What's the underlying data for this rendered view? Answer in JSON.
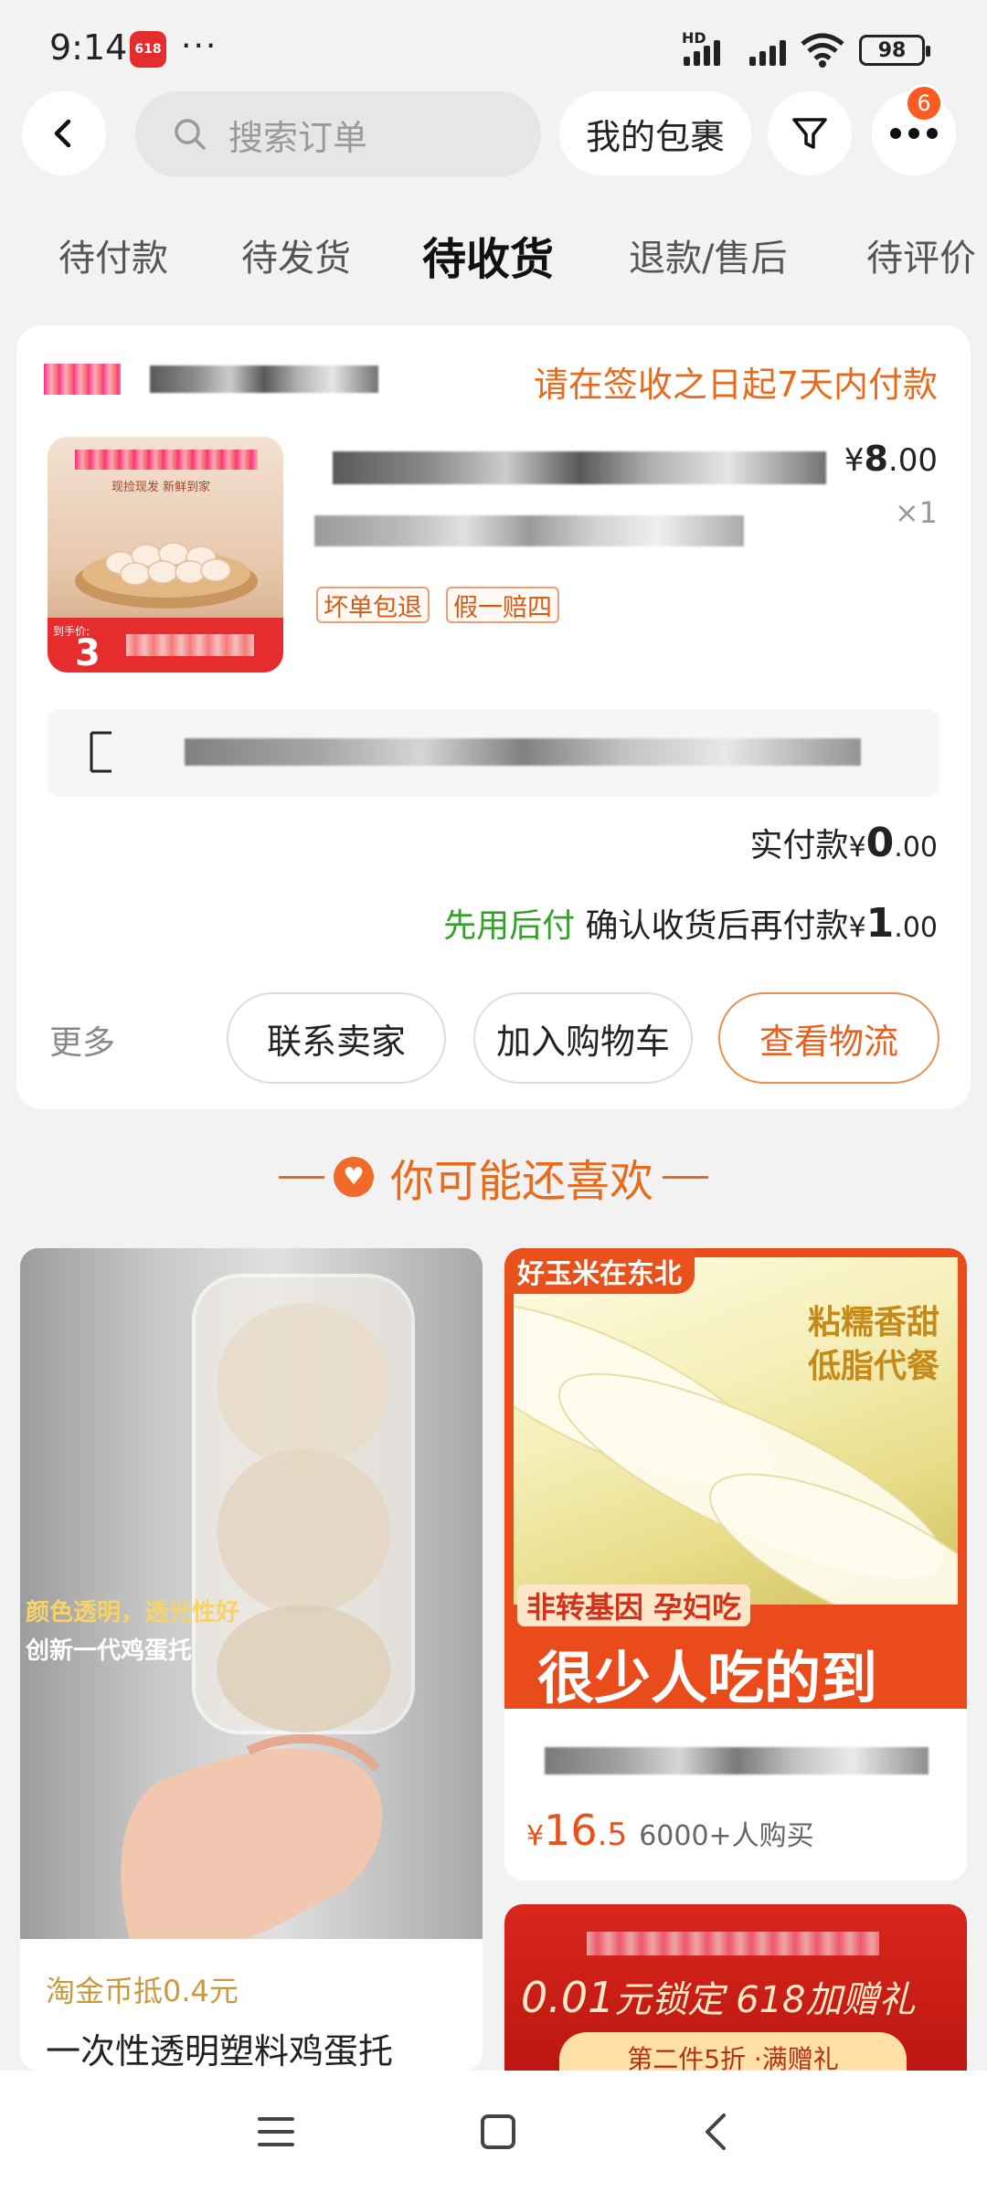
{
  "status_bar": {
    "time": "9:14",
    "app_badge_text": "618",
    "more_dots": "···",
    "network_label": "HD",
    "battery": "98"
  },
  "header": {
    "search_placeholder": "搜索订单",
    "my_packages": "我的包裹",
    "notification_count": "6"
  },
  "tabs": [
    {
      "label": "待付款",
      "active": false
    },
    {
      "label": "待发货",
      "active": false
    },
    {
      "label": "待收货",
      "active": true
    },
    {
      "label": "退款/售后",
      "active": false
    },
    {
      "label": "待评价",
      "active": false
    }
  ],
  "order": {
    "payment_notice": "请在签收之日起7天内付款",
    "thumb_text_top": "现捡现发 新鲜到家",
    "thumb_price_label": "到手价:",
    "thumb_price": "3",
    "unit_price_symbol": "¥",
    "unit_price_int": "8",
    "unit_price_dec": ".00",
    "quantity": "×1",
    "tags": [
      "坏单包退",
      "假一赔四"
    ],
    "paid_label": "实付款",
    "paid_symbol": "¥",
    "paid_int": "0",
    "paid_dec": ".00",
    "later_pay_label": "先用后付",
    "later_pay_text": "确认收货后再付款",
    "later_symbol": "¥",
    "later_int": "1",
    "later_dec": ".00",
    "more": "更多",
    "buttons": {
      "contact": "联系卖家",
      "add_cart": "加入购物车",
      "logistics": "查看物流"
    }
  },
  "recommend": {
    "title": "你可能还喜欢",
    "left_item": {
      "image_caption_1": "颜色透明，透光性好",
      "image_caption_2": "创新一代鸡蛋托",
      "coupon": "淘金币抵0.4元",
      "title": "一次性透明塑料鸡蛋托"
    },
    "right_item": {
      "banner_tag": "好玉米在东北",
      "banner_side_1": "粘糯香甜",
      "banner_side_2": "低脂代餐",
      "banner_sub": "非转基因 孕妇吃",
      "banner_big": "很少人吃的到",
      "price_symbol": "¥",
      "price_int": "16",
      "price_dec": ".5",
      "sold": "6000+人购买"
    },
    "right_item_2": {
      "banner_text_price": "0.01",
      "banner_text_rest": "元锁定 618加赠礼",
      "banner_sub": "第二件5折 ·满赠礼"
    }
  },
  "colors": {
    "accent_orange": "#e86a1c",
    "green": "#34a02b",
    "badge": "#ff5a1f"
  }
}
